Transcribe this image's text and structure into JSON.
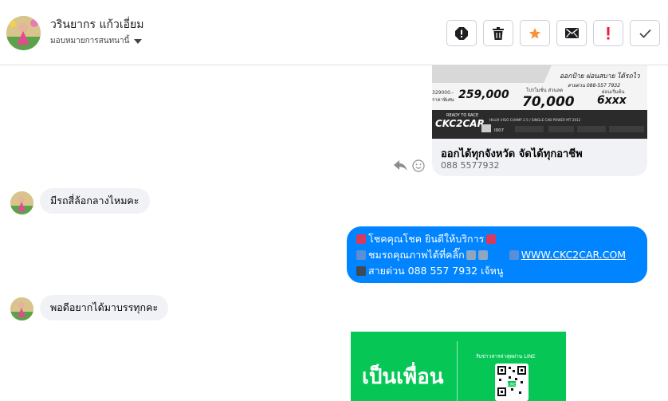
{
  "contact": {
    "name": "วรินยากร แก้วเอี่ยม",
    "assign_label": "มอบหมายการสนทนานี้"
  },
  "toolbar": {
    "buttons": [
      "spam-report",
      "delete",
      "star",
      "mark-unread",
      "important",
      "done"
    ]
  },
  "colors": {
    "outgoing_bubble": "#0084ff",
    "incoming_bubble": "#f0f2f5",
    "star": "#f7923a",
    "important": "#e41e3f",
    "line_green": "#06c755"
  },
  "messages": {
    "card": {
      "image_texts": {
        "headline": "ออกป้าย ผ่อนสบาย ได้รถไว",
        "hotline": "สายด่วน 088-557 7932",
        "price_label": "ราคาพิเศษ",
        "price_old": "329000.-",
        "price": "259,000",
        "promo_label": "โปรโมชั่น ส่วนลด",
        "promo": "70,000",
        "installment_label": "ผ่อนเริ่มต้น",
        "installment": "6xxx",
        "ready": "READY TO RACE",
        "brand": "CKC2CAR",
        "model": "HILUX VIGO CHAMP 2.5 / SINGLE CAB POWER MT 2012",
        "code": "I007"
      },
      "title": "ออกได้ทุกจังหวัด จัดได้ทุกอาชีพ",
      "subtitle": "088 5577932"
    },
    "incoming_1": "มีรถสี่ล้อกลางไหมคะ",
    "outgoing": {
      "line1": "โชคคุณโชค ยินดีให้บริการ",
      "line2": "ชมรถคุณภาพได้ที่คลิ๊ก",
      "link": "WWW.CKC2CAR.COM",
      "line3": "สายด่วน 088 557 7932 เจ้หนู"
    },
    "incoming_2": "พอดีอยากได้มาบรรทุกคะ",
    "line_banner": {
      "big_text": "เป็นเพื่อน",
      "small_text": "รับข่าวสารล่าสุดผ่าน LINE",
      "qr_label": "LINE"
    }
  }
}
